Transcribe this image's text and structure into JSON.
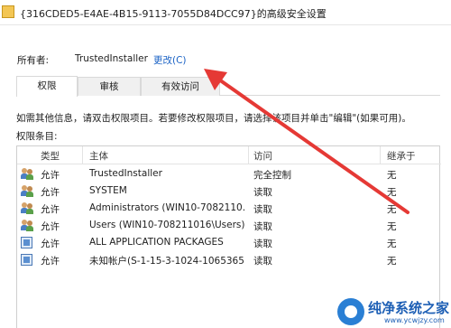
{
  "window": {
    "title": "{316CDED5-E4AE-4B15-9113-7055D84DCC97}的高级安全设置"
  },
  "owner": {
    "label": "所有者:",
    "value": "TrustedInstaller",
    "change_link": "更改(C)"
  },
  "tabs": [
    {
      "label": "权限",
      "active": true
    },
    {
      "label": "审核",
      "active": false
    },
    {
      "label": "有效访问",
      "active": false
    }
  ],
  "description": "如需其他信息，请双击权限项目。若要修改权限项目，请选择该项目并单击\"编辑\"(如果可用)。",
  "entries_label": "权限条目:",
  "table": {
    "headers": [
      "类型",
      "主体",
      "访问",
      "继承于"
    ],
    "rows": [
      {
        "icon": "users-icon",
        "type": "允许",
        "principal": "TrustedInstaller",
        "access": "完全控制",
        "inherited": "无"
      },
      {
        "icon": "users-icon",
        "type": "允许",
        "principal": "SYSTEM",
        "access": "读取",
        "inherited": "无"
      },
      {
        "icon": "users-icon",
        "type": "允许",
        "principal": "Administrators (WIN10-7082110...",
        "access": "读取",
        "inherited": "无"
      },
      {
        "icon": "users-icon",
        "type": "允许",
        "principal": "Users (WIN10-708211016\\Users)",
        "access": "读取",
        "inherited": "无"
      },
      {
        "icon": "package-icon",
        "type": "允许",
        "principal": "ALL APPLICATION PACKAGES",
        "access": "读取",
        "inherited": "无"
      },
      {
        "icon": "package-icon",
        "type": "允许",
        "principal": "未知帐户(S-1-15-3-1024-1065365...",
        "access": "读取",
        "inherited": "无"
      }
    ]
  },
  "watermark": {
    "text": "纯净系统之家",
    "url": "www.ycwjzy.com"
  },
  "colors": {
    "link": "#1a62c5",
    "annotation_arrow": "#e53935"
  }
}
